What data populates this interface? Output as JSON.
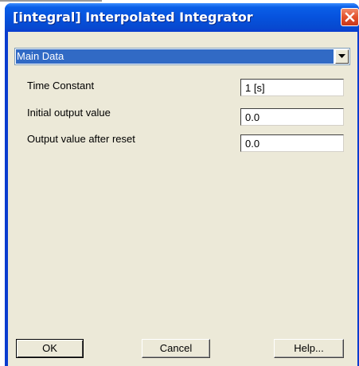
{
  "window": {
    "title": "[integral] Interpolated Integrator",
    "colors": {
      "titlebar": "#0652dd",
      "client": "#ece9d8",
      "selection": "#316ac5",
      "close": "#e2522c"
    }
  },
  "page_select": {
    "selected": "Main Data",
    "arrow_icon": "chevron-down-icon"
  },
  "fields": [
    {
      "label": "Time Constant",
      "value": "1 [s]"
    },
    {
      "label": "Initial output value",
      "value": "0.0"
    },
    {
      "label": "Output value after reset",
      "value": "0.0"
    }
  ],
  "buttons": {
    "ok": "OK",
    "cancel": "Cancel",
    "help": "Help..."
  }
}
